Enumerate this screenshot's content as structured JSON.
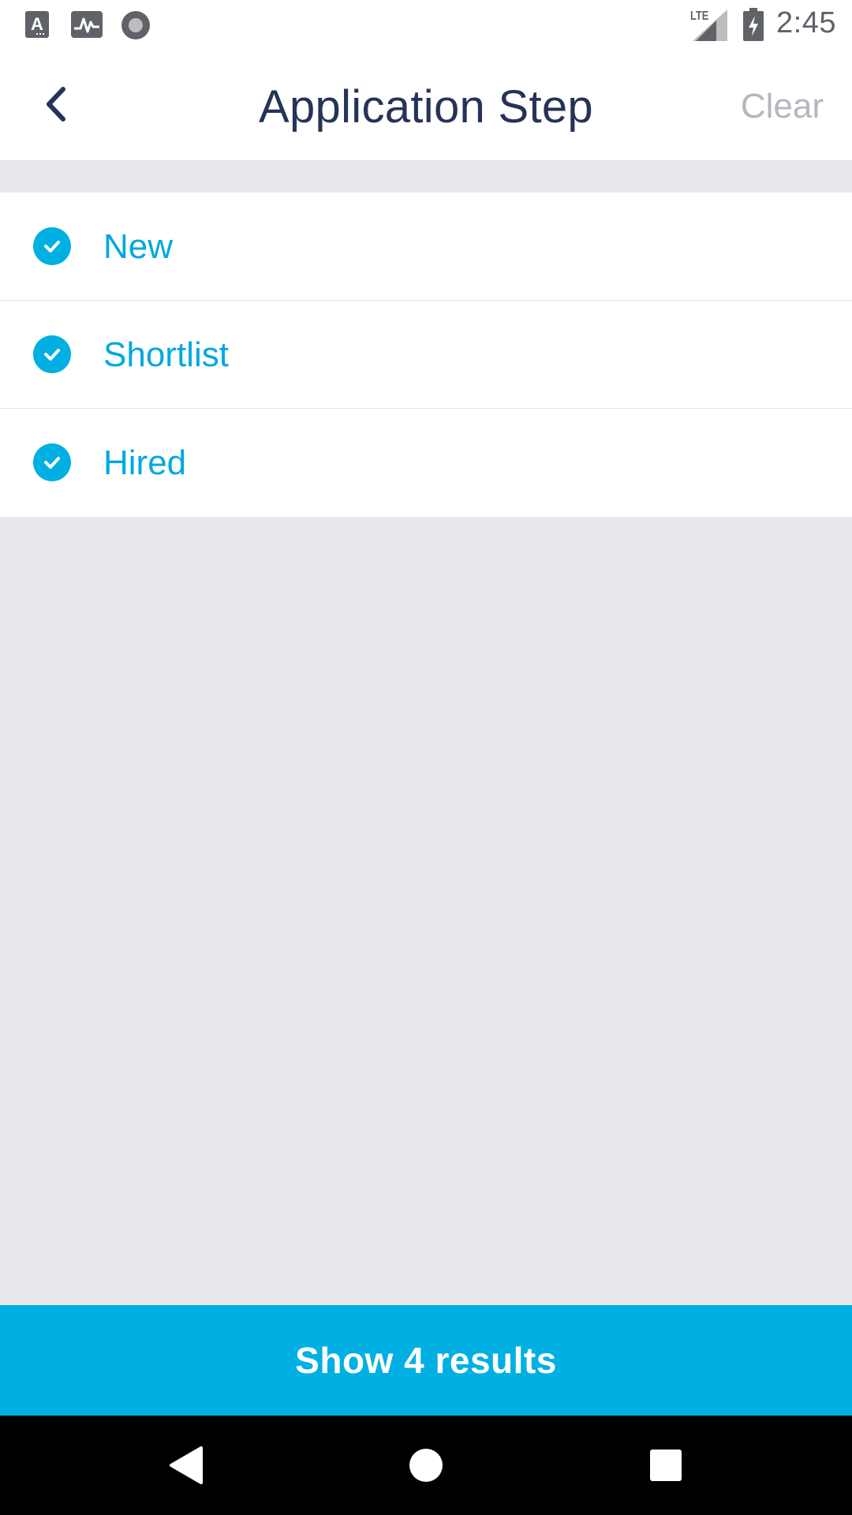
{
  "status_bar": {
    "time": "2:45",
    "network": "LTE",
    "left_icons": [
      "text-a-icon",
      "activity-icon",
      "circle-icon"
    ],
    "right_icons": [
      "signal-icon",
      "battery-charging-icon"
    ]
  },
  "header": {
    "title": "Application Step",
    "clear_label": "Clear",
    "back_icon": "chevron-left-icon"
  },
  "options": [
    {
      "label": "New",
      "checked": true
    },
    {
      "label": "Shortlist",
      "checked": true
    },
    {
      "label": "Hired",
      "checked": true
    }
  ],
  "action": {
    "label": "Show 4 results"
  },
  "colors": {
    "accent": "#00b0e2",
    "title": "#263358",
    "muted": "#b4b7bf",
    "background": "#e8e8ee"
  }
}
